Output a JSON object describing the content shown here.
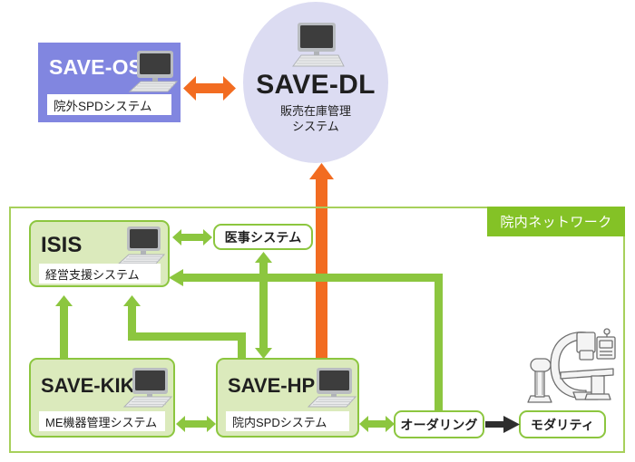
{
  "diagram": {
    "title_nodes": {
      "save_os": {
        "name": "SAVE-OS",
        "subtitle": "院外SPDシステム",
        "color": "#8186e0",
        "icon": "desktop-computer-icon"
      },
      "save_dl": {
        "name": "SAVE-DL",
        "subtitle_line1": "販売在庫管理",
        "subtitle_line2": "システム",
        "color": "#dcdcf2",
        "icon": "desktop-computer-icon"
      },
      "isis": {
        "name": "ISIS",
        "subtitle": "経営支援システム",
        "color": "#dbeabc",
        "icon": "desktop-computer-icon"
      },
      "save_kiki": {
        "name": "SAVE-KIKI",
        "subtitle": "ME機器管理システム",
        "color": "#dbeabc",
        "icon": "desktop-computer-icon"
      },
      "save_hp": {
        "name": "SAVE-HP",
        "subtitle": "院内SPDシステム",
        "color": "#dbeabc",
        "icon": "desktop-computer-icon"
      }
    },
    "pill_nodes": {
      "medical_system": "医事システム",
      "ordering": "オーダリング",
      "modality": "モダリティ"
    },
    "network_frame": {
      "label": "院内ネットワーク",
      "label_bg": "#84c226",
      "border_color": "#a7d05b"
    },
    "equipment": {
      "modality_machine": "c-arm-xray-machine-icon"
    },
    "connector_colors": {
      "orange": "#f26c21",
      "green": "#8cc63f",
      "dark": "#2e2e2e"
    },
    "connections": [
      {
        "from": "SAVE-OS",
        "to": "SAVE-DL",
        "style": "bidirectional",
        "color": "#f26c21"
      },
      {
        "from": "SAVE-HP",
        "to": "SAVE-DL",
        "style": "directed-up",
        "color": "#f26c21"
      },
      {
        "from": "ISIS",
        "to": "医事システム",
        "style": "bidirectional",
        "color": "#8cc63f"
      },
      {
        "from": "医事システム",
        "to": "SAVE-HP",
        "style": "bidirectional",
        "color": "#8cc63f"
      },
      {
        "from": "SAVE-KIKI",
        "to": "ISIS",
        "style": "directed-up",
        "color": "#8cc63f"
      },
      {
        "from": "SAVE-HP",
        "to": "ISIS",
        "style": "directed-up",
        "color": "#8cc63f"
      },
      {
        "from": "オーダリング",
        "to": "ISIS",
        "style": "directed-left",
        "color": "#8cc63f"
      },
      {
        "from": "SAVE-KIKI",
        "to": "SAVE-HP",
        "style": "bidirectional",
        "color": "#8cc63f"
      },
      {
        "from": "SAVE-HP",
        "to": "オーダリング",
        "style": "bidirectional",
        "color": "#8cc63f"
      },
      {
        "from": "オーダリング",
        "to": "モダリティ",
        "style": "directed-right",
        "color": "#2e2e2e"
      }
    ]
  }
}
